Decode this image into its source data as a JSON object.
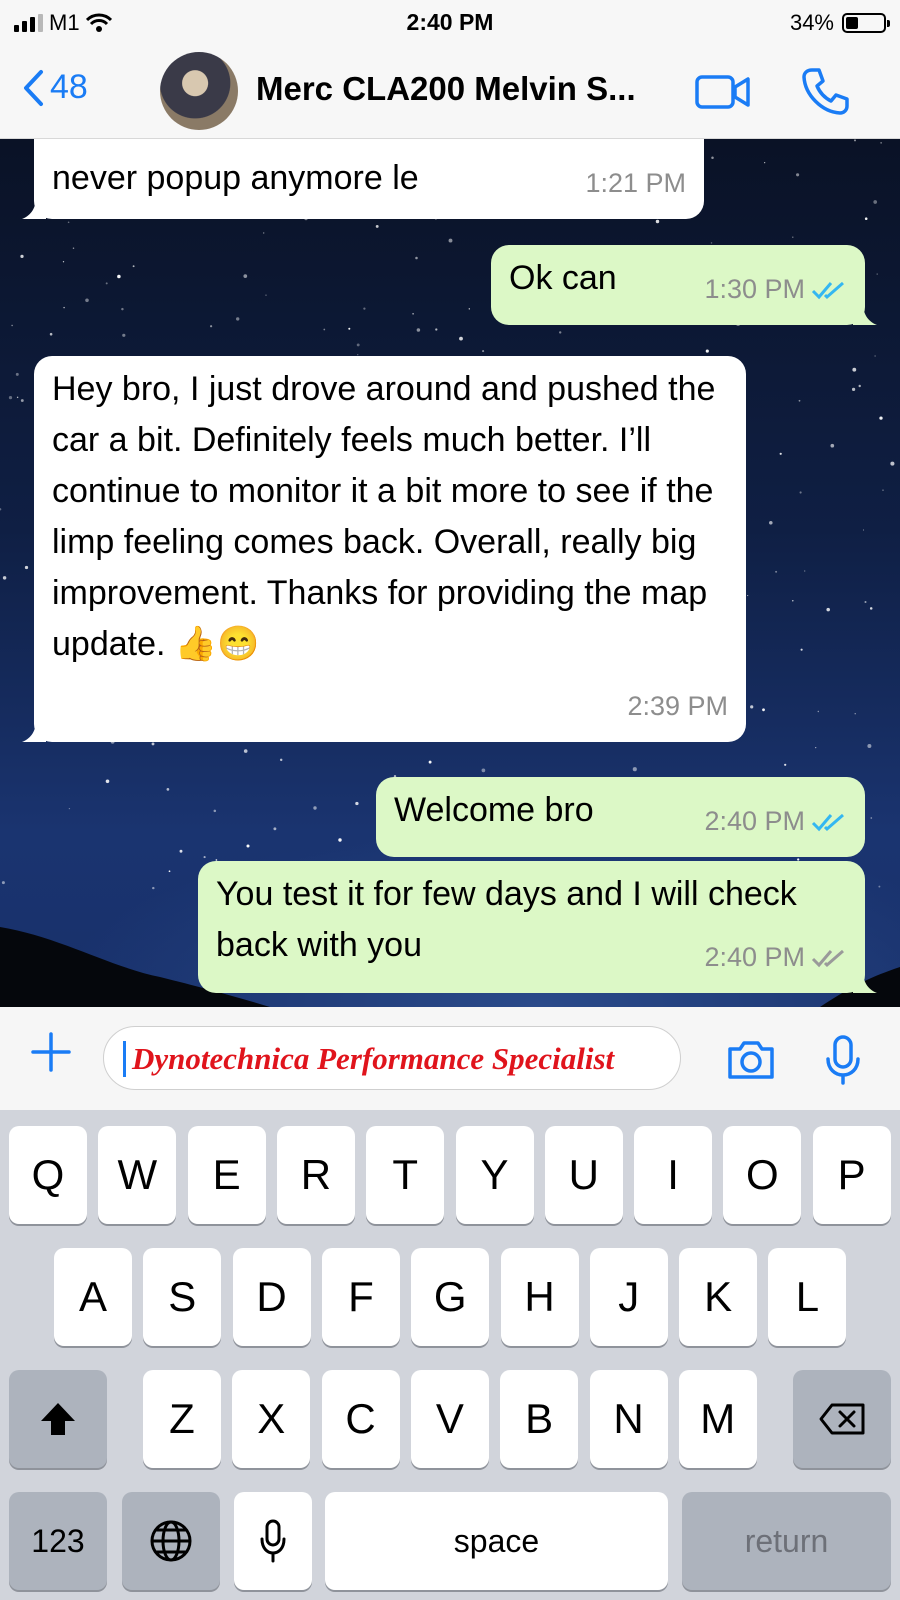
{
  "status_bar": {
    "carrier": "M1",
    "time": "2:40 PM",
    "battery": "34%",
    "battery_level": 0.34
  },
  "nav": {
    "back_count": "48",
    "title": "Merc CLA200 Melvin S..."
  },
  "messages": [
    {
      "direction": "incoming",
      "text": "never popup anymore le",
      "time": "1:21 PM"
    },
    {
      "direction": "outgoing",
      "text": "Ok can",
      "time": "1:30 PM",
      "receipt": "read"
    },
    {
      "direction": "incoming",
      "text": "Hey bro, I just drove around and pushed the car a bit. Definitely feels much better. I’ll continue to monitor it a bit more to see if the limp feeling comes back. Overall, really big improvement. Thanks for providing the map update. 👍😁",
      "time": "2:39 PM"
    },
    {
      "direction": "outgoing",
      "text": "Welcome bro",
      "time": "2:40 PM",
      "receipt": "read"
    },
    {
      "direction": "outgoing",
      "text": "You test it for few days and I will check back with you",
      "time": "2:40 PM",
      "receipt": "delivered"
    }
  ],
  "composer": {
    "value": "Dynotechnica Performance Specialist"
  },
  "keyboard": {
    "row1": [
      "Q",
      "W",
      "E",
      "R",
      "T",
      "Y",
      "U",
      "I",
      "O",
      "P"
    ],
    "row2": [
      "A",
      "S",
      "D",
      "F",
      "G",
      "H",
      "J",
      "K",
      "L"
    ],
    "row3": [
      "Z",
      "X",
      "C",
      "V",
      "B",
      "N",
      "M"
    ],
    "numbers_label": "123",
    "space_label": "space",
    "return_label": "return"
  },
  "colors": {
    "accent": "#1a7cf5",
    "outgoing_bubble": "#dcf8c6",
    "incoming_bubble": "#ffffff",
    "read_tick": "#34b7f1",
    "composer_text": "#e0141c"
  },
  "icons": [
    "back-chevron-icon",
    "video-call-icon",
    "phone-icon",
    "plus-icon",
    "camera-icon",
    "mic-icon",
    "shift-icon",
    "backspace-icon",
    "globe-icon",
    "dictation-mic-icon",
    "read-receipt-icon"
  ]
}
